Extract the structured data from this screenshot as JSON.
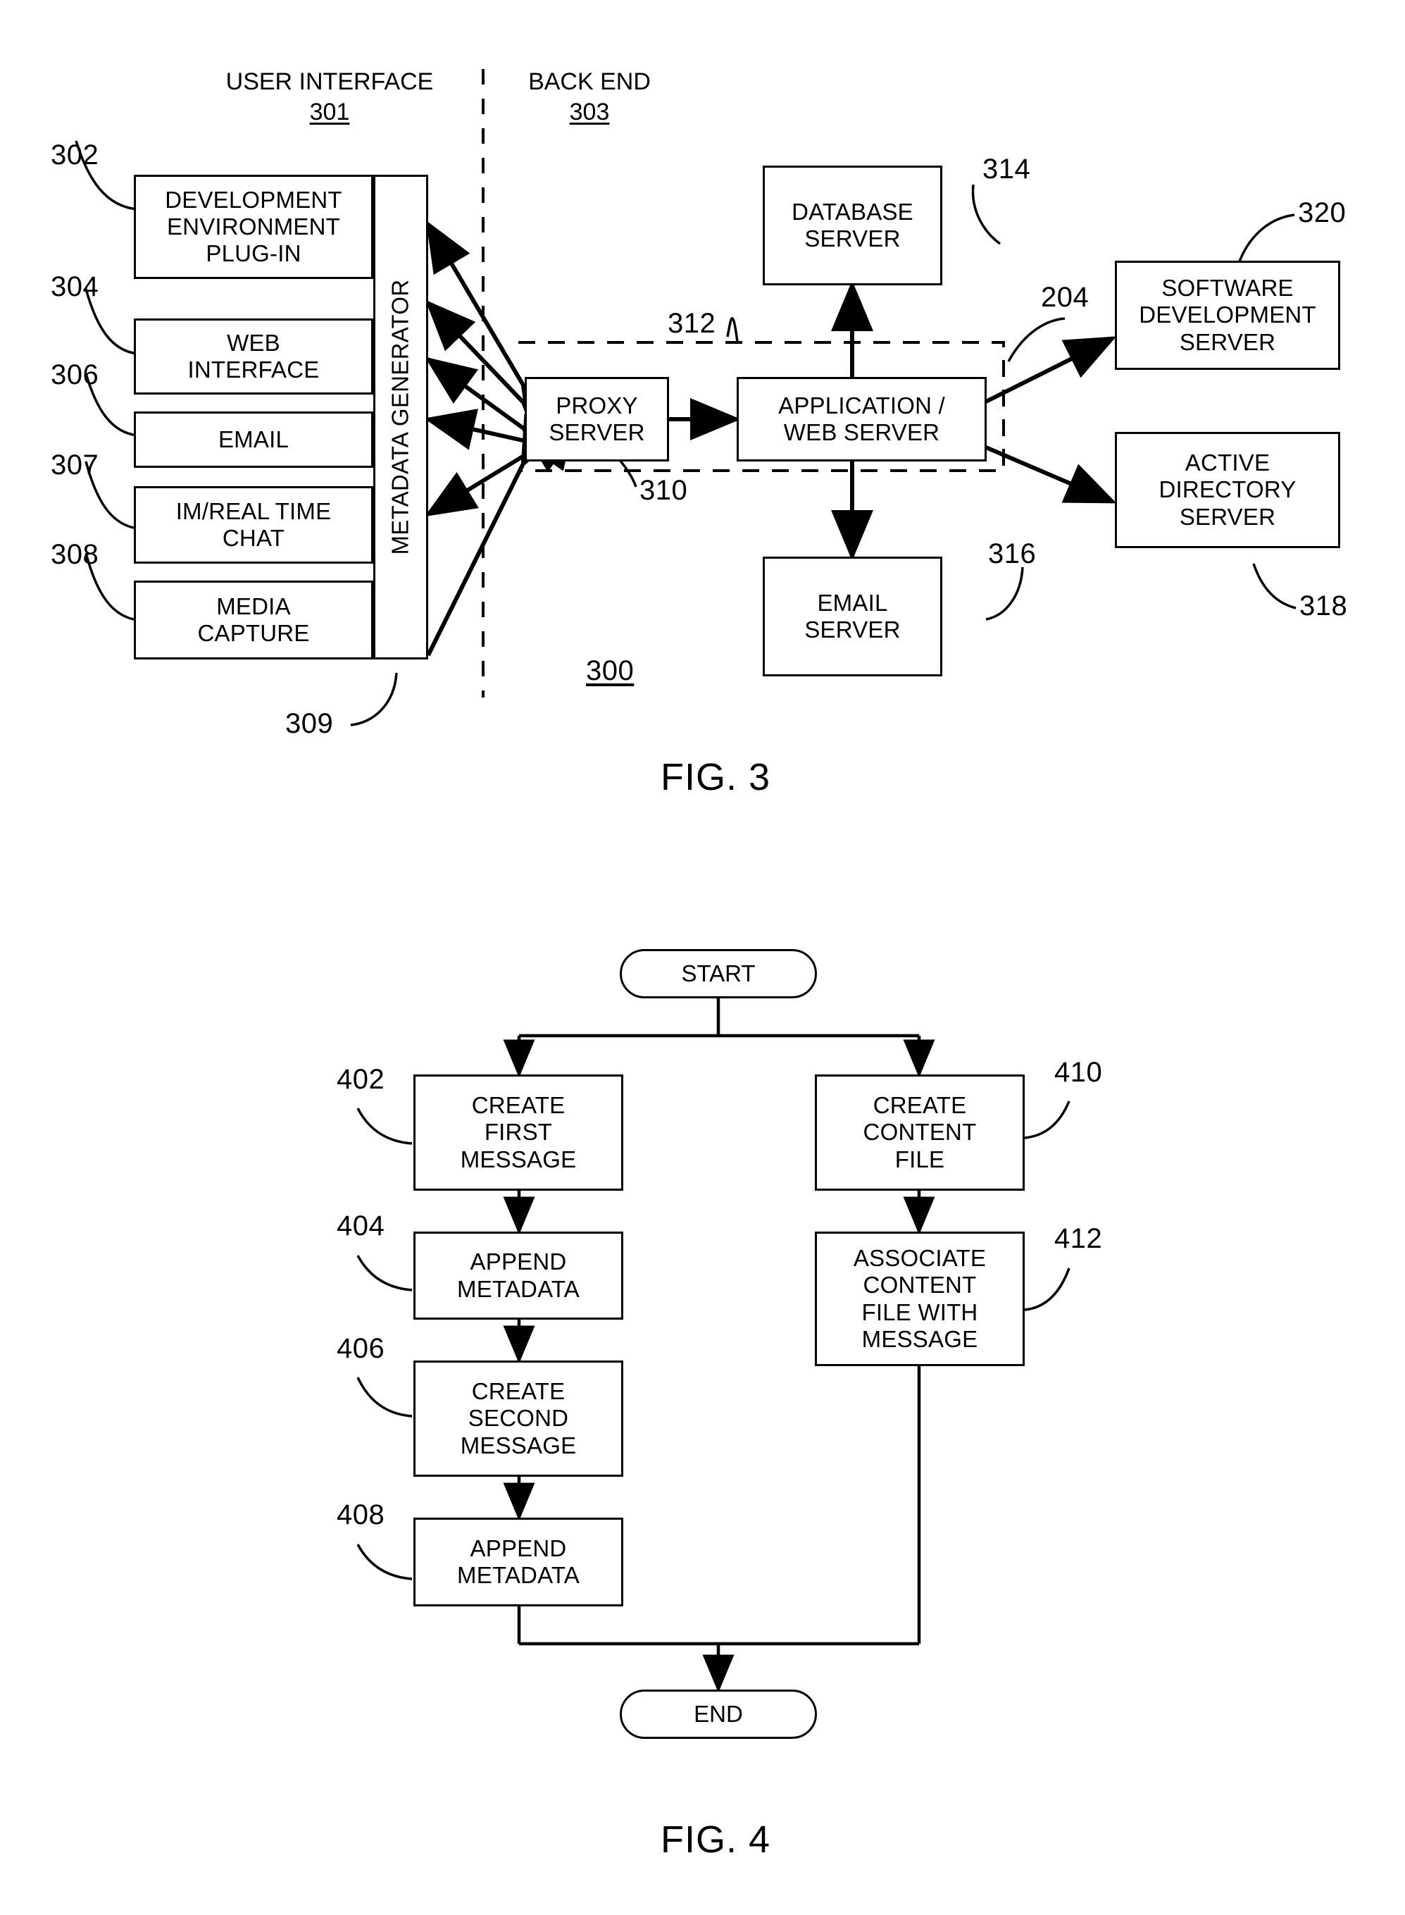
{
  "figure3": {
    "caption": "FIG. 3",
    "system_ref": "300",
    "sections": [
      {
        "title": "USER INTERFACE",
        "ref": "301"
      },
      {
        "title": "BACK END",
        "ref": "303"
      }
    ],
    "ui_components": [
      {
        "ref": "302",
        "label": "DEVELOPMENT\nENVIRONMENT\nPLUG-IN"
      },
      {
        "ref": "304",
        "label": "WEB\nINTERFACE"
      },
      {
        "ref": "306",
        "label": "EMAIL"
      },
      {
        "ref": "307",
        "label": "IM/REAL TIME\nCHAT"
      },
      {
        "ref": "308",
        "label": "MEDIA\nCAPTURE"
      }
    ],
    "metadata_generator": {
      "ref": "309",
      "label": "METADATA GENERATOR"
    },
    "backend_components": [
      {
        "ref": "310",
        "label": "PROXY\nSERVER"
      },
      {
        "ref": "312",
        "label": "APPLICATION /\nWEB SERVER"
      },
      {
        "ref": "314",
        "label": "DATABASE\nSERVER"
      },
      {
        "ref": "316",
        "label": "EMAIL\nSERVER"
      },
      {
        "ref": "320",
        "label": "SOFTWARE\nDEVELOPMENT\nSERVER"
      },
      {
        "ref": "318",
        "label": "ACTIVE\nDIRECTORY\nSERVER"
      }
    ],
    "network_ref": "204"
  },
  "figure4": {
    "caption": "FIG. 4",
    "start_label": "START",
    "end_label": "END",
    "left_branch": [
      {
        "ref": "402",
        "label": "CREATE\nFIRST\nMESSAGE"
      },
      {
        "ref": "404",
        "label": "APPEND\nMETADATA"
      },
      {
        "ref": "406",
        "label": "CREATE\nSECOND\nMESSAGE"
      },
      {
        "ref": "408",
        "label": "APPEND\nMETADATA"
      }
    ],
    "right_branch": [
      {
        "ref": "410",
        "label": "CREATE\nCONTENT\nFILE"
      },
      {
        "ref": "412",
        "label": "ASSOCIATE\nCONTENT\nFILE WITH\nMESSAGE"
      }
    ]
  }
}
